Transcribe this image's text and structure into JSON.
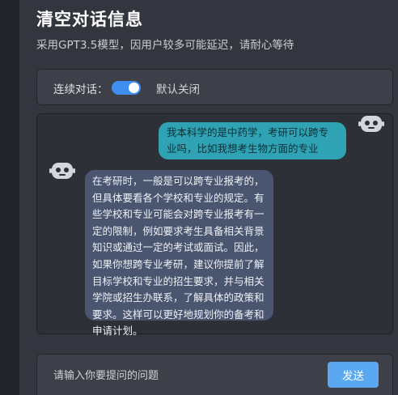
{
  "header": {
    "title": "清空对话信息",
    "subtitle": "采用GPT3.5模型，因用户较多可能延迟，请耐心等待"
  },
  "settings": {
    "toggle_label": "连续对话：",
    "toggle_on": true,
    "toggle_state_text": "默认关闭"
  },
  "chat": {
    "messages": [
      {
        "role": "user",
        "text": "我本科学的是中药学，考研可以跨专业吗，比如我想考生物方面的专业"
      },
      {
        "role": "assistant",
        "text": "在考研时，一般是可以跨专业报考的，但具体要看各个学校和专业的规定。有些学校和专业可能会对跨专业报考有一定的限制，例如要求考生具备相关背景知识或通过一定的考试或面试。因此，如果你想跨专业考研，建议你提前了解目标学校和专业的招生要求，并与相关学院或招生办联系，了解具体的政策和要求。这样可以更好地规划你的备考和申请计划。"
      }
    ]
  },
  "input": {
    "placeholder": "请输入你要提问的问题",
    "value": "",
    "send_label": "发送"
  },
  "colors": {
    "accent": "#3f8ef0",
    "user_bubble": "#2fa3b4",
    "ai_bubble": "#4a5670",
    "send_button": "#5aa9f0"
  }
}
